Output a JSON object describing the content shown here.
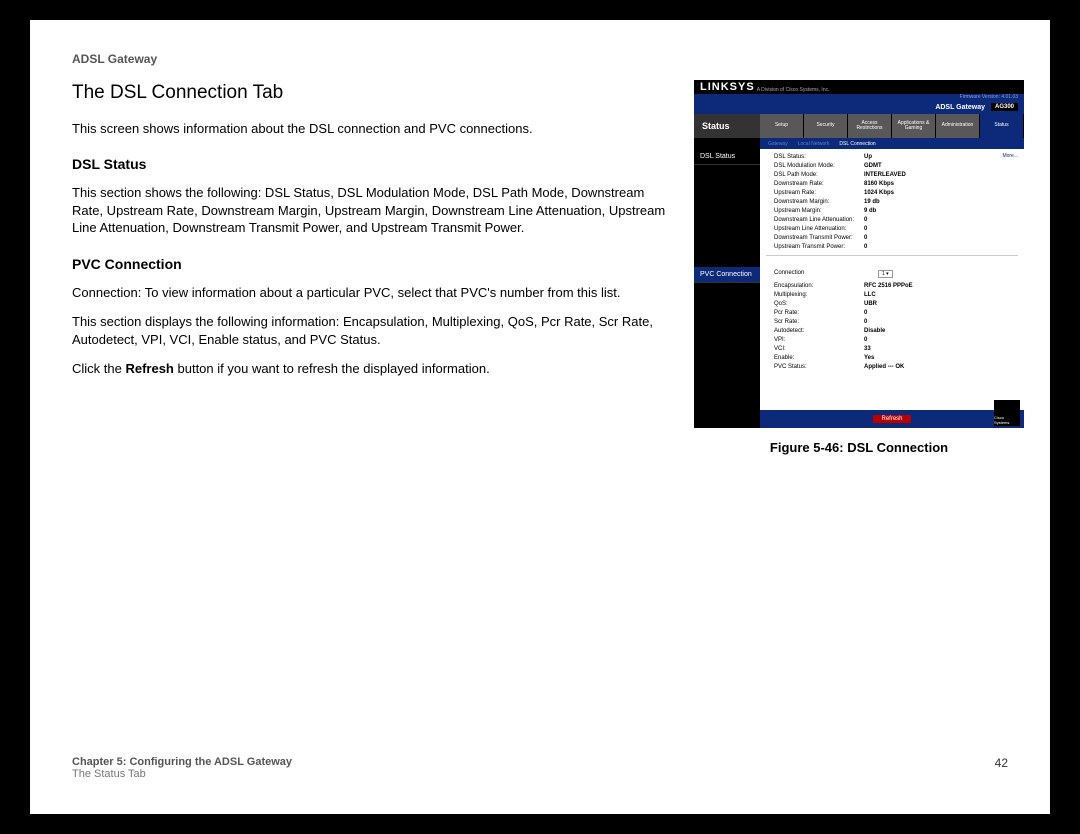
{
  "header": "ADSL Gateway",
  "title": "The DSL Connection Tab",
  "p_intro": "This screen shows information about the DSL connection and PVC connections.",
  "h_dsl": "DSL Status",
  "p_dsl": "This section shows the following: DSL Status, DSL Modulation Mode, DSL Path Mode, Downstream Rate, Upstream Rate, Downstream Margin, Upstream Margin, Downstream Line Attenuation, Upstream Line Attenuation, Downstream Transmit Power, and Upstream Transmit Power.",
  "h_pvc": "PVC Connection",
  "p_pvc1": "Connection: To view information about a particular PVC, select that PVC's number from this list.",
  "p_pvc2": "This section displays the following information: Encapsulation, Multiplexing, QoS, Pcr Rate, Scr Rate, Autodetect, VPI, VCI, Enable status, and PVC Status.",
  "refresh_pre": "Click the ",
  "refresh_bold": "Refresh",
  "refresh_post": " button if you want to refresh the displayed information.",
  "caption": "Figure 5-46: DSL Connection",
  "foot_chapter": "Chapter 5: Configuring the ADSL Gateway",
  "foot_sub": "The Status Tab",
  "page_no": "42",
  "shot": {
    "brand": "LINKSYS",
    "subbrand": "A Division of Cisco Systems, Inc.",
    "fw": "Firmware Version: 4.01.03",
    "gw": "ADSL Gateway",
    "model": "AG300",
    "side_label": "Status",
    "tabs": [
      "Setup",
      "Security",
      "Access Restrictions",
      "Applications & Gaming",
      "Administration",
      "Status"
    ],
    "subtabs": [
      "Gateway",
      "Local Network",
      "DSL Connection"
    ],
    "sec1": "DSL Status",
    "sec2": "PVC Connection",
    "more": "More...",
    "dsl": [
      [
        "DSL Status:",
        "Up"
      ],
      [
        "DSL Modulation Mode:",
        "GDMT"
      ],
      [
        "DSL Path Mode:",
        "INTERLEAVED"
      ],
      [
        "Downstream Rate:",
        "8160 Kbps"
      ],
      [
        "Upstream Rate:",
        "1024 Kbps"
      ],
      [
        "Downstream Margin:",
        "19 db"
      ],
      [
        "Upstream Margin:",
        "9 db"
      ],
      [
        "Downstream Line Attenuation:",
        "0"
      ],
      [
        "Upstream Line Attenuation:",
        "0"
      ],
      [
        "Downstream Transmit Power:",
        "0"
      ],
      [
        "Upstream Transmit Power:",
        "0"
      ]
    ],
    "conn_label": "Connection",
    "conn_value": "1 ▾",
    "pvc": [
      [
        "Encapsulation:",
        "RFC 2516 PPPoE"
      ],
      [
        "Multiplexing:",
        "LLC"
      ],
      [
        "QoS:",
        "UBR"
      ],
      [
        "Pcr Rate:",
        "0"
      ],
      [
        "Scr Rate:",
        "0"
      ],
      [
        "Autodetect:",
        "Disable"
      ],
      [
        "VPI:",
        "0"
      ],
      [
        "VCI:",
        "33"
      ],
      [
        "Enable:",
        "Yes"
      ],
      [
        "PVC Status:",
        "Applied --- OK"
      ]
    ],
    "refresh": "Refresh",
    "cisco": "Cisco Systems"
  }
}
